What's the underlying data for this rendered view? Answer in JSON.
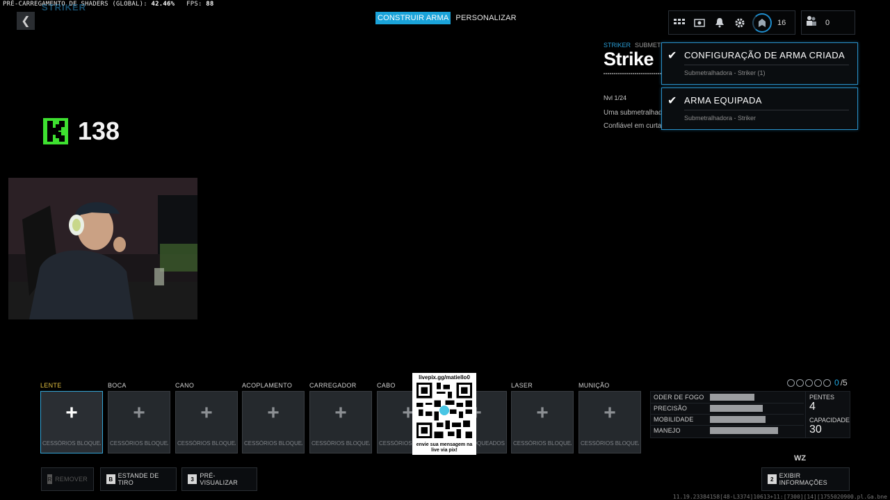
{
  "overlay": {
    "shader_label": "PRÉ-CARREGAMENTO DE SHADERS (GLOBAL):",
    "shader_value": "42.46%",
    "fps_label": "FPS:",
    "fps_value": "88"
  },
  "header": {
    "back_glyph": "❮",
    "weapon_title": "STRIKER",
    "tabs": [
      {
        "label": "CONSTRUIR ARMA",
        "active": true
      },
      {
        "label": "PERSONALIZAR",
        "active": false
      }
    ],
    "rank_level": "16",
    "party_count": "0",
    "icons": [
      "grid-icon",
      "camera-icon",
      "bell-icon",
      "gear-icon",
      "rank-icon",
      "party-icon"
    ]
  },
  "weapon_info": {
    "name_tag": "STRIKER",
    "category_tag": "SUBMETRA",
    "name": "Strike",
    "level": "Nvl 1/24",
    "desc_line1": "Uma submetralhad",
    "desc_line2": "Confiável em curta"
  },
  "notifications": [
    {
      "title": "CONFIGURAÇÃO DE ARMA CRIADA",
      "subtitle": "Submetralhadora - Striker (1)"
    },
    {
      "title": "ARMA EQUIPADA",
      "subtitle": "Submetralhadora - Striker"
    }
  ],
  "stream_overlay": {
    "kick_count": "138",
    "qr_url": "livepix.gg/matiello0",
    "qr_message_1": "envie sua mensagem na",
    "qr_message_2": "live via pix!"
  },
  "attachments": [
    {
      "label": "LENTE",
      "locked_text": "CESSÓRIOS BLOQUEADOS",
      "active": true
    },
    {
      "label": "BOCA",
      "locked_text": "CESSÓRIOS BLOQUEADOS",
      "active": false
    },
    {
      "label": "CANO",
      "locked_text": "CESSÓRIOS BLOQUEADOS",
      "active": false
    },
    {
      "label": "ACOPLAMENTO",
      "locked_text": "CESSÓRIOS BLOQUEADOS",
      "active": false
    },
    {
      "label": "CARREGADOR",
      "locked_text": "CESSÓRIOS BLOQUEADOS",
      "active": false
    },
    {
      "label": "CABO",
      "locked_text": "CESSÓRIOS BLO",
      "active": false
    },
    {
      "label": "",
      "locked_text": "LOQUEADOS",
      "active": false
    },
    {
      "label": "LASER",
      "locked_text": "CESSÓRIOS BLOQUEADOS",
      "active": false
    },
    {
      "label": "MUNIÇÃO",
      "locked_text": "CESSÓRIOS BLOQUEADOS",
      "active": false
    }
  ],
  "attachment_count": {
    "current": "0",
    "max": "/5",
    "pips": 5
  },
  "stats": [
    {
      "name": "ODER DE FOGO",
      "value": 0.47
    },
    {
      "name": "PRECISÃO",
      "value": 0.56
    },
    {
      "name": "MOBILIDADE",
      "value": 0.59
    },
    {
      "name": "MANEJO",
      "value": 0.72
    }
  ],
  "ammo": {
    "mags_label": "PENTES",
    "mags_value": "4",
    "capacity_label": "CAPACIDADE",
    "capacity_value": "30"
  },
  "wz_tag": "WZ",
  "footer": {
    "buttons": [
      {
        "key": "R",
        "label": "REMOVER",
        "disabled": true
      },
      {
        "key": "B",
        "label": "ESTANDE DE TIRO",
        "disabled": false
      },
      {
        "key": "3",
        "label": "PRÉ-VISUALIZAR",
        "disabled": false
      },
      {
        "key": "2",
        "label": "EXIBIR INFORMAÇÕES",
        "disabled": false
      }
    ],
    "debug": "11.19.23384158[48-L3374]10613+11:[7300][14][1755020900.pl.Ga.bne"
  },
  "colors": {
    "accent": "#1aa3d9",
    "active_label": "#e2c040",
    "kick_green": "#3ee030"
  }
}
